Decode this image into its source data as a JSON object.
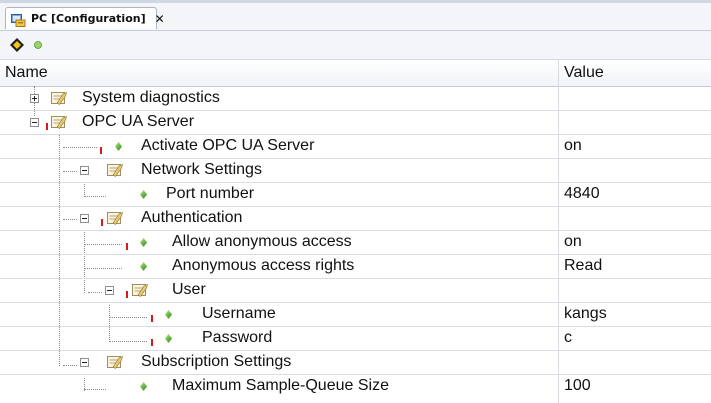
{
  "tab": {
    "title": "PC [Configuration]",
    "close_glyph": "✕"
  },
  "toolbar": {
    "buttons": [
      "navigate-icon",
      "status-dot-icon"
    ]
  },
  "columns": {
    "name": "Name",
    "value": "Value"
  },
  "tree": [
    {
      "label": "System diagnostics",
      "value": "",
      "kind": "folder",
      "expander": "collapsed"
    },
    {
      "label": "OPC UA Server",
      "value": "",
      "kind": "folder",
      "expander": "expanded"
    },
    {
      "label": "Activate OPC UA Server",
      "value": "on",
      "kind": "parameter"
    },
    {
      "label": "Network Settings",
      "value": "",
      "kind": "folder",
      "expander": "expanded"
    },
    {
      "label": "Port number",
      "value": "4840",
      "kind": "parameter"
    },
    {
      "label": "Authentication",
      "value": "",
      "kind": "folder",
      "expander": "expanded"
    },
    {
      "label": "Allow anonymous access",
      "value": "on",
      "kind": "parameter"
    },
    {
      "label": "Anonymous access rights",
      "value": "Read",
      "kind": "parameter"
    },
    {
      "label": "User",
      "value": "",
      "kind": "folder",
      "expander": "expanded"
    },
    {
      "label": "Username",
      "value": "kangs",
      "kind": "parameter"
    },
    {
      "label": "Password",
      "value": "c",
      "kind": "parameter"
    },
    {
      "label": "Subscription Settings",
      "value": "",
      "kind": "folder",
      "expander": "expanded"
    },
    {
      "label": "Maximum Sample-Queue Size",
      "value": "100",
      "kind": "parameter"
    }
  ],
  "colors": {
    "required_marker": "#d61b1b",
    "parameter_icon": "#5fb43a",
    "folder_icon": "#e8c870"
  }
}
